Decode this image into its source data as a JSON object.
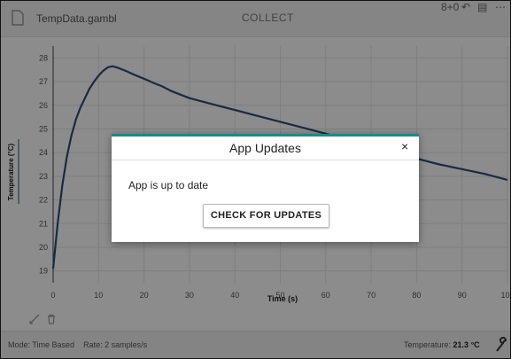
{
  "app": {
    "file_name": "TempData.gambl",
    "collect_label": "COLLECT",
    "top_icon_text": "8+0"
  },
  "colors": {
    "accent": "#1a8b87",
    "series": "#2c4f78"
  },
  "chart_data": {
    "type": "line",
    "xlabel": "Time (s)",
    "ylabel": "Temperature (°C)",
    "xlim": [
      0,
      100
    ],
    "ylim": [
      18.5,
      28.5
    ],
    "x_ticks": [
      "0",
      "10",
      "20",
      "30",
      "40",
      "50",
      "60",
      "70",
      "80",
      "90",
      "100"
    ],
    "y_ticks": [
      "19",
      "20",
      "21",
      "22",
      "23",
      "24",
      "25",
      "26",
      "27",
      "28"
    ],
    "grid": true,
    "series": [
      {
        "name": "",
        "x": [
          0,
          1,
          2,
          3,
          4,
          5,
          6,
          7,
          8,
          9,
          10,
          11,
          12,
          13,
          14,
          16,
          18,
          20,
          22,
          24,
          26,
          28,
          30,
          35,
          40,
          45,
          50,
          55,
          60,
          65,
          70,
          75,
          80,
          85,
          90,
          95,
          100
        ],
        "y": [
          19.1,
          21.0,
          22.6,
          23.8,
          24.7,
          25.4,
          25.9,
          26.3,
          26.7,
          27.0,
          27.25,
          27.45,
          27.6,
          27.65,
          27.6,
          27.45,
          27.28,
          27.12,
          26.95,
          26.8,
          26.6,
          26.45,
          26.3,
          26.05,
          25.8,
          25.55,
          25.3,
          25.05,
          24.8,
          24.55,
          24.3,
          24.0,
          23.75,
          23.5,
          23.3,
          23.1,
          22.85
        ]
      }
    ]
  },
  "tools": {
    "left_icons": [
      "draw-icon",
      "delete-icon"
    ]
  },
  "dialog": {
    "title": "App Updates",
    "close_glyph": "×",
    "message": "App is up to date",
    "button_label": "CHECK FOR UPDATES"
  },
  "status": {
    "mode_label": "Mode: Time Based",
    "rate_label": "Rate: 2 samples/s",
    "temp_prefix": "Temperature:",
    "temp_value": "21.3 °C"
  }
}
